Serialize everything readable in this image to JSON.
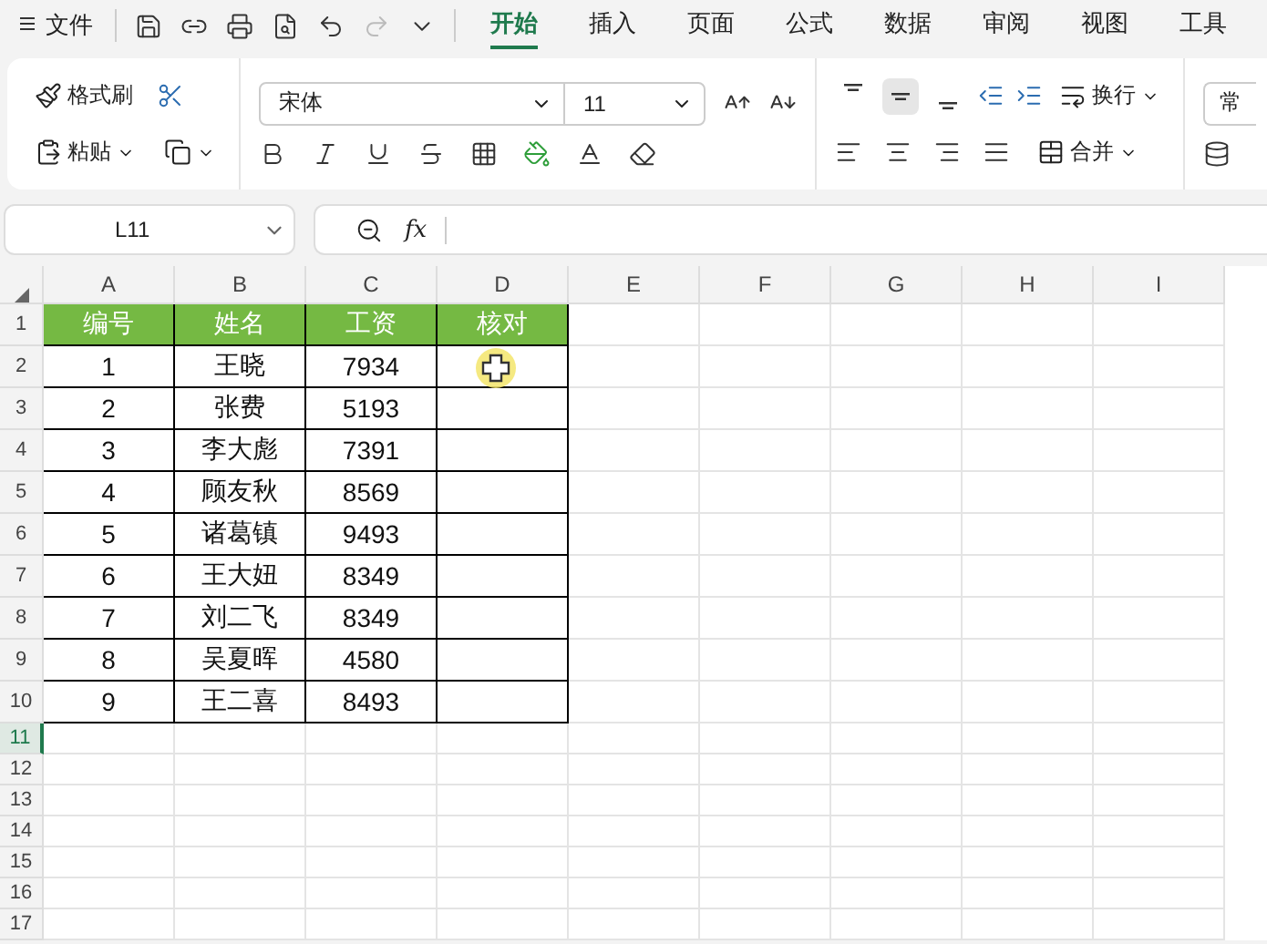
{
  "menu": {
    "file": "文件",
    "redo": {
      "disabled": true
    },
    "tabs": [
      {
        "label": "开始",
        "selected": true
      },
      {
        "label": "插入",
        "selected": false
      },
      {
        "label": "页面",
        "selected": false
      },
      {
        "label": "公式",
        "selected": false
      },
      {
        "label": "数据",
        "selected": false
      },
      {
        "label": "审阅",
        "selected": false
      },
      {
        "label": "视图",
        "selected": false
      },
      {
        "label": "工具",
        "selected": false
      }
    ]
  },
  "ribbon": {
    "format_painter": "格式刷",
    "paste": "粘贴",
    "font": "宋体",
    "size": "11",
    "wrap": "换行",
    "merge": "合并",
    "number_format": "常",
    "vertical_align": [
      {
        "kind": "top",
        "selected": false
      },
      {
        "kind": "middle",
        "selected": true
      },
      {
        "kind": "bottom",
        "selected": false
      }
    ]
  },
  "formula_bar": {
    "cell_ref": "L11",
    "function_label": "fx"
  },
  "sheet": {
    "columns": [
      "A",
      "B",
      "C",
      "D",
      "E",
      "F",
      "G",
      "H",
      "I"
    ],
    "rows": [
      {
        "label": "1",
        "selected": false,
        "kind": "header",
        "cells": [
          "编号",
          "姓名",
          "工资",
          "核对"
        ]
      },
      {
        "label": "2",
        "selected": false,
        "kind": "data",
        "cells": [
          "1",
          "王晓",
          "7934"
        ]
      },
      {
        "label": "3",
        "selected": false,
        "kind": "data",
        "cells": [
          "2",
          "张费",
          "5193"
        ]
      },
      {
        "label": "4",
        "selected": false,
        "kind": "data",
        "cells": [
          "3",
          "李大彪",
          "7391"
        ]
      },
      {
        "label": "5",
        "selected": false,
        "kind": "data",
        "cells": [
          "4",
          "顾友秋",
          "8569"
        ]
      },
      {
        "label": "6",
        "selected": false,
        "kind": "data",
        "cells": [
          "5",
          "诸葛镇",
          "9493"
        ]
      },
      {
        "label": "7",
        "selected": false,
        "kind": "data",
        "cells": [
          "6",
          "王大妞",
          "8349"
        ]
      },
      {
        "label": "8",
        "selected": false,
        "kind": "data",
        "cells": [
          "7",
          "刘二飞",
          "8349"
        ]
      },
      {
        "label": "9",
        "selected": false,
        "kind": "data",
        "cells": [
          "8",
          "吴夏晖",
          "4580"
        ]
      },
      {
        "label": "10",
        "selected": false,
        "kind": "data",
        "cells": [
          "9",
          "王二喜",
          "8493"
        ]
      },
      {
        "label": "11",
        "selected": true
      },
      {
        "label": "12",
        "selected": false
      },
      {
        "label": "13",
        "selected": false
      },
      {
        "label": "14",
        "selected": false
      },
      {
        "label": "15",
        "selected": false
      },
      {
        "label": "16",
        "selected": false
      },
      {
        "label": "17",
        "selected": false
      }
    ]
  }
}
